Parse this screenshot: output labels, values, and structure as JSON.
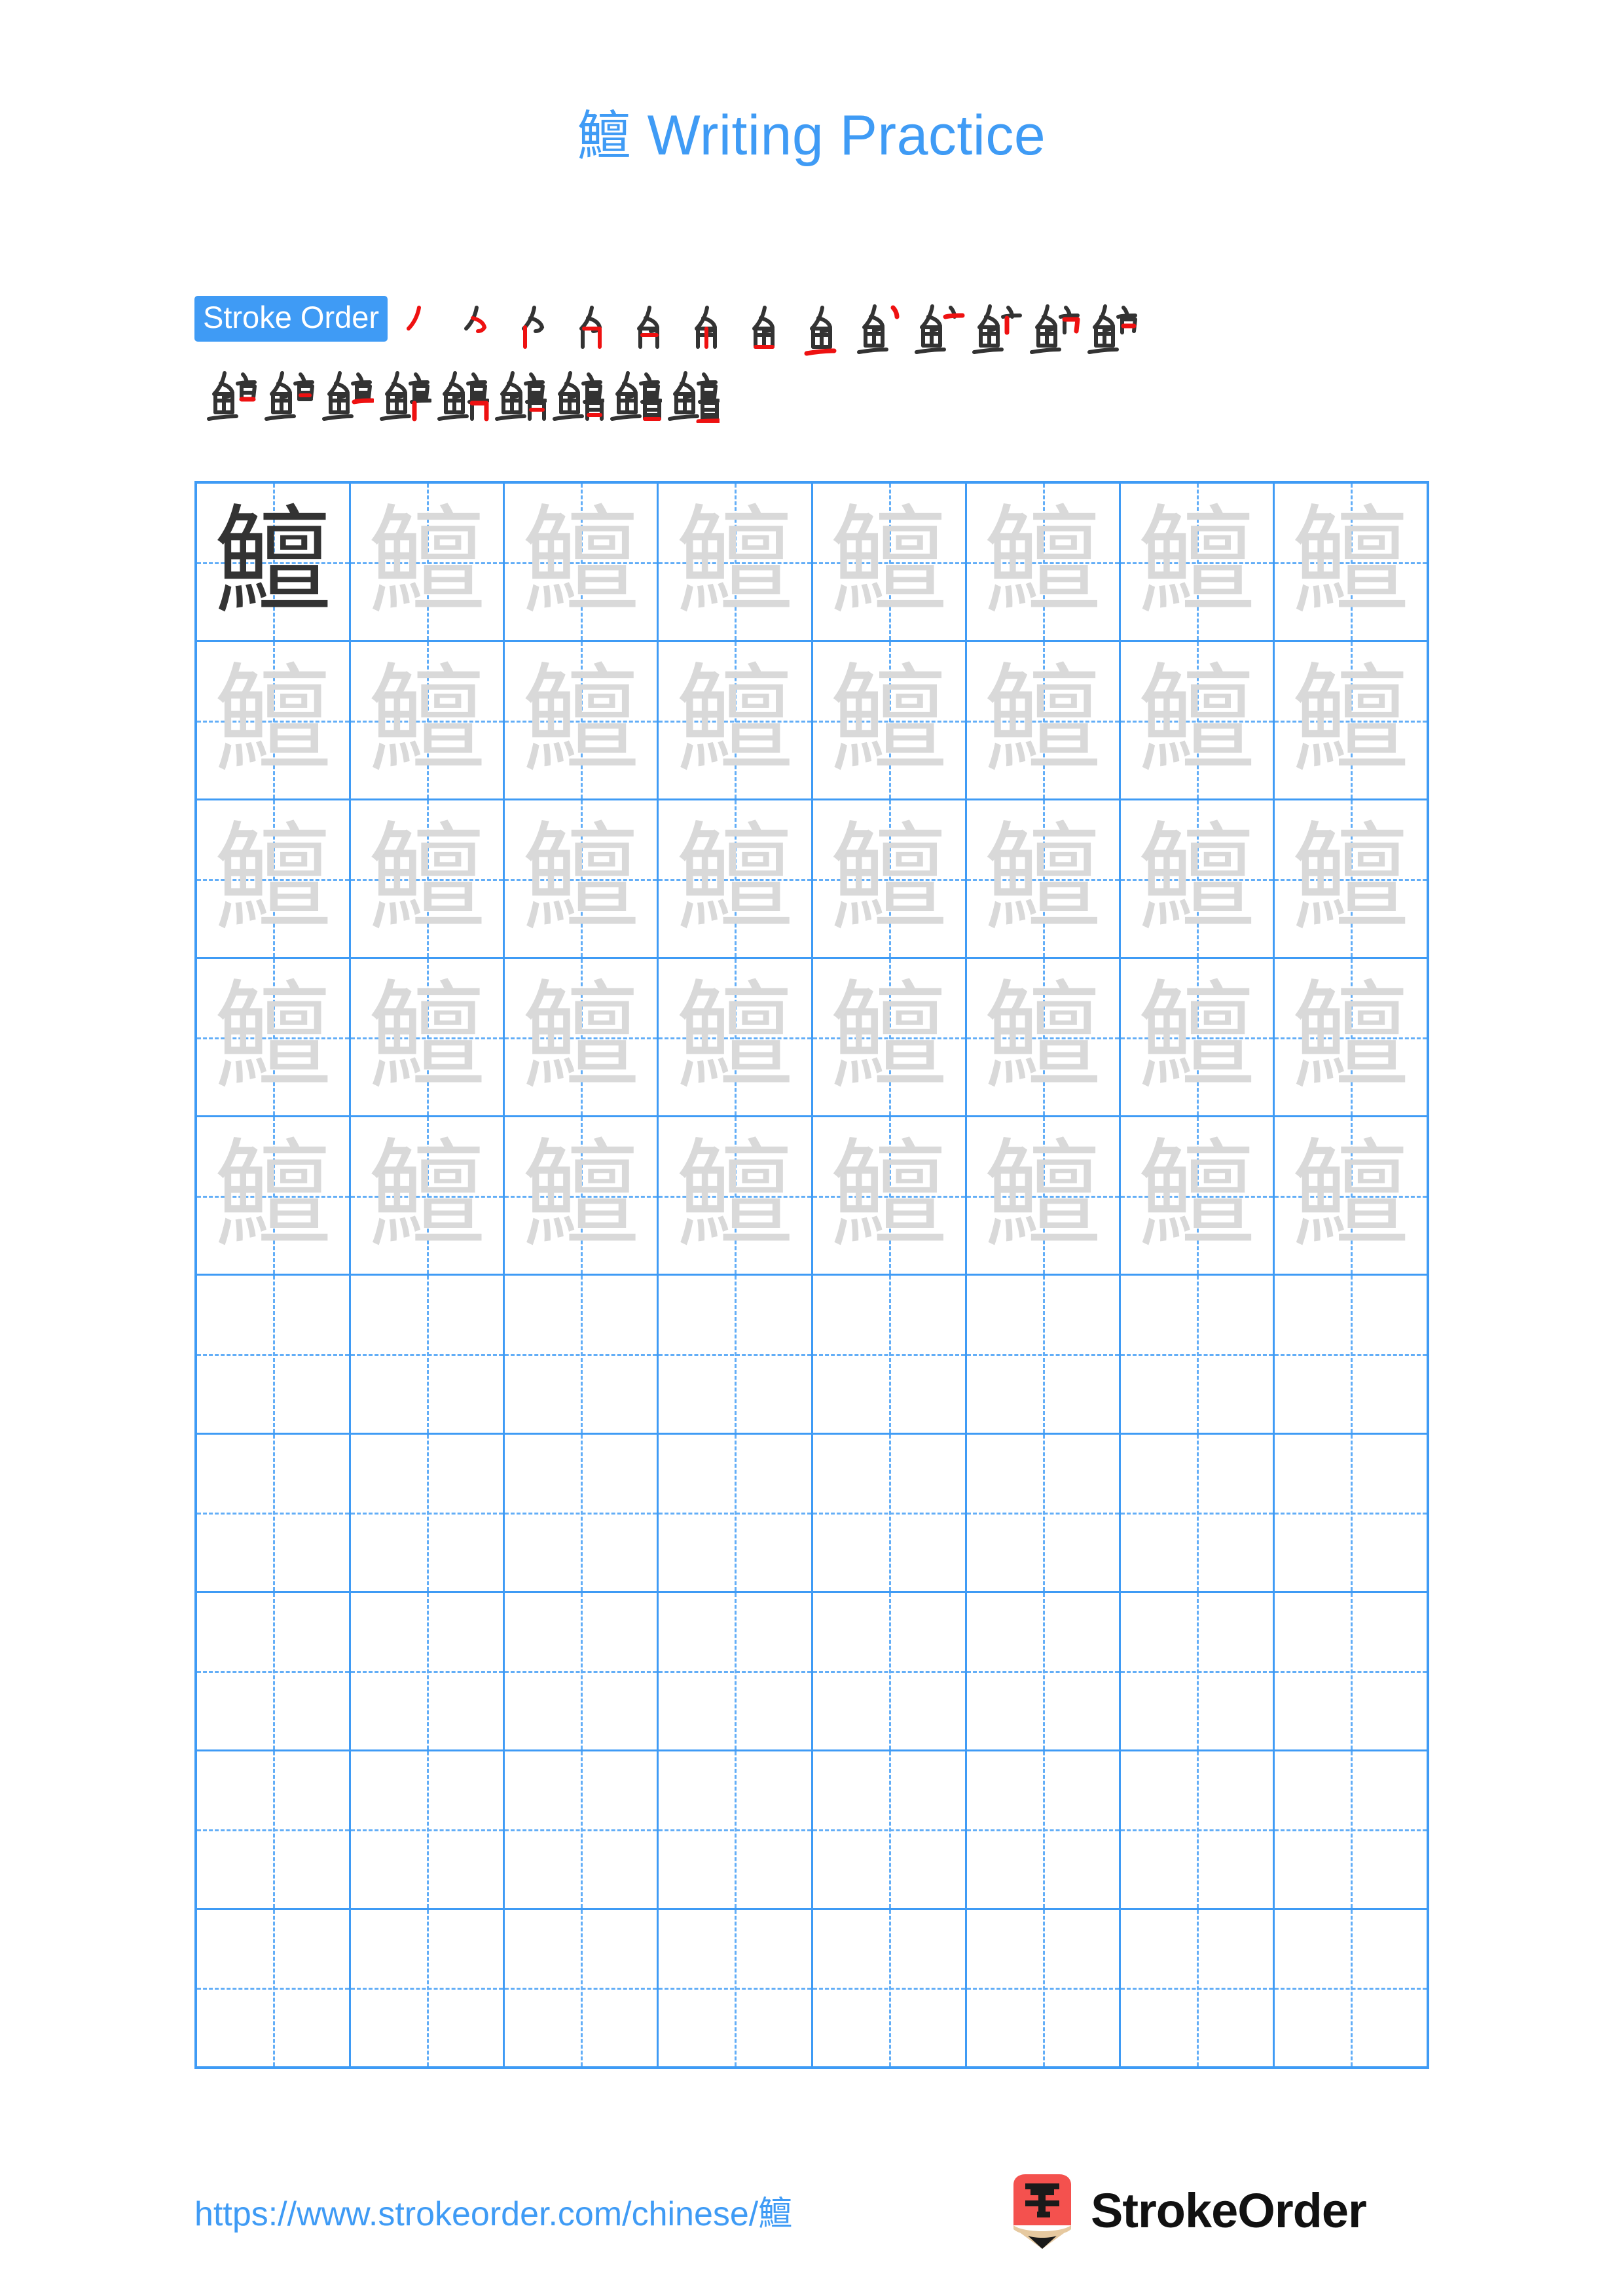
{
  "page": {
    "background": "#ffffff",
    "accent_blue": "#3f9bf5",
    "grid_line_blue": "#63aef7",
    "dark_glyph": "#333333",
    "faint_glyph": "#d9d9d9",
    "stroke_highlight_red": "#ee1111",
    "stroke_prior_dark": "#333333"
  },
  "header": {
    "character": "鱣",
    "title_suffix": " Writing Practice",
    "full_title": "鱣 Writing Practice"
  },
  "stroke_order": {
    "label": "Stroke Order",
    "total_strokes": 22,
    "row1_count": 13,
    "row2_count": 9,
    "steps": [
      "鱣 stroke 1",
      "鱣 stroke 2",
      "鱣 stroke 3",
      "鱣 stroke 4",
      "鱣 stroke 5",
      "鱣 stroke 6",
      "鱣 stroke 7",
      "鱣 stroke 8",
      "鱣 stroke 9",
      "鱣 stroke 10",
      "鱣 stroke 11",
      "鱣 stroke 12",
      "鱣 stroke 13",
      "鱣 stroke 14",
      "鱣 stroke 15",
      "鱣 stroke 16",
      "鱣 stroke 17",
      "鱣 stroke 18",
      "鱣 stroke 19",
      "鱣 stroke 20",
      "鱣 stroke 21",
      "鱣 stroke 22"
    ]
  },
  "practice_grid": {
    "columns": 8,
    "rows": 10,
    "filled_rows": 5,
    "empty_rows": 5,
    "dark_cell_index": 0,
    "character": "鱣",
    "rows_data": [
      [
        "鱣",
        "鱣",
        "鱣",
        "鱣",
        "鱣",
        "鱣",
        "鱣",
        "鱣"
      ],
      [
        "鱣",
        "鱣",
        "鱣",
        "鱣",
        "鱣",
        "鱣",
        "鱣",
        "鱣"
      ],
      [
        "鱣",
        "鱣",
        "鱣",
        "鱣",
        "鱣",
        "鱣",
        "鱣",
        "鱣"
      ],
      [
        "鱣",
        "鱣",
        "鱣",
        "鱣",
        "鱣",
        "鱣",
        "鱣",
        "鱣"
      ],
      [
        "鱣",
        "鱣",
        "鱣",
        "鱣",
        "鱣",
        "鱣",
        "鱣",
        "鱣"
      ],
      [
        "",
        "",
        "",
        "",
        "",
        "",
        "",
        ""
      ],
      [
        "",
        "",
        "",
        "",
        "",
        "",
        "",
        ""
      ],
      [
        "",
        "",
        "",
        "",
        "",
        "",
        "",
        ""
      ],
      [
        "",
        "",
        "",
        "",
        "",
        "",
        "",
        ""
      ],
      [
        "",
        "",
        "",
        "",
        "",
        "",
        "",
        ""
      ]
    ]
  },
  "footer": {
    "url": "https://www.strokeorder.com/chinese/鱣",
    "brand_name": "StrokeOrder",
    "logo_character": "字",
    "logo_body_color": "#f4514e",
    "logo_wood_color": "#e6c9a0",
    "logo_tip_color": "#1a1a1a"
  }
}
